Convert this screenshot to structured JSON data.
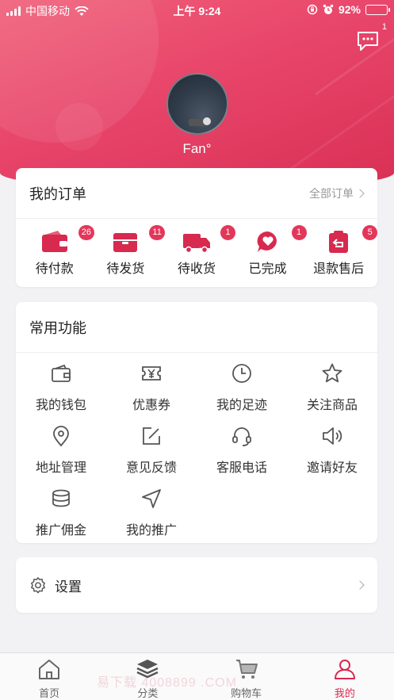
{
  "status_bar": {
    "carrier": "中国移动",
    "time": "上午 9:24",
    "battery": "92%",
    "battery_level": 0.92
  },
  "header": {
    "message_badge": "1",
    "username": "Fan°"
  },
  "orders": {
    "title": "我的订单",
    "all_link": "全部订单",
    "items": [
      {
        "label": "待付款",
        "badge": "26",
        "icon": "wallet-icon"
      },
      {
        "label": "待发货",
        "badge": "11",
        "icon": "package-icon"
      },
      {
        "label": "待收货",
        "badge": "1",
        "icon": "truck-icon"
      },
      {
        "label": "已完成",
        "badge": "1",
        "icon": "heart-bubble-icon"
      },
      {
        "label": "退款售后",
        "badge": "5",
        "icon": "refund-icon"
      }
    ]
  },
  "functions": {
    "title": "常用功能",
    "items": [
      {
        "label": "我的钱包",
        "icon": "wallet-icon"
      },
      {
        "label": "优惠券",
        "icon": "coupon-icon"
      },
      {
        "label": "我的足迹",
        "icon": "clock-icon"
      },
      {
        "label": "关注商品",
        "icon": "star-icon"
      },
      {
        "label": "地址管理",
        "icon": "location-pin-icon"
      },
      {
        "label": "意见反馈",
        "icon": "edit-icon"
      },
      {
        "label": "客服电话",
        "icon": "headset-icon"
      },
      {
        "label": "邀请好友",
        "icon": "speaker-icon"
      },
      {
        "label": "推广佣金",
        "icon": "coins-icon"
      },
      {
        "label": "我的推广",
        "icon": "navigation-icon"
      }
    ]
  },
  "settings": {
    "label": "设置"
  },
  "tabbar": {
    "items": [
      {
        "label": "首页",
        "icon": "home-icon"
      },
      {
        "label": "分类",
        "icon": "layers-icon"
      },
      {
        "label": "购物车",
        "icon": "cart-icon"
      },
      {
        "label": "我的",
        "icon": "user-icon",
        "active": true
      }
    ]
  },
  "watermark": "易下载 4008899    .COM",
  "colors": {
    "accent": "#d8294f",
    "hero": "#e8456a",
    "badge": "#e3375a"
  }
}
